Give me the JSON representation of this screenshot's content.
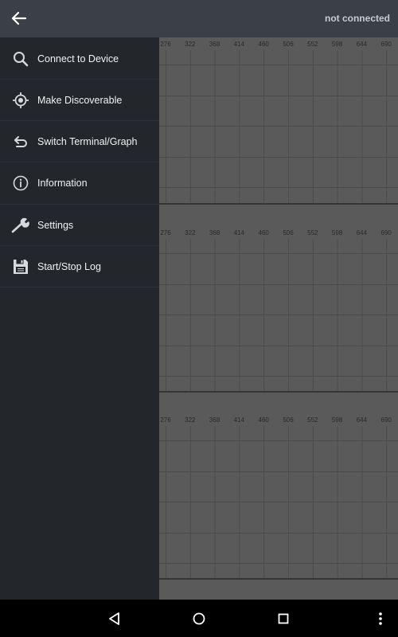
{
  "header": {
    "status_text": "not connected"
  },
  "menu": {
    "items": [
      {
        "label": "Connect to Device",
        "icon": "search-icon"
      },
      {
        "label": "Make Discoverable",
        "icon": "target-icon"
      },
      {
        "label": "Switch Terminal/Graph",
        "icon": "undo-icon"
      },
      {
        "label": "Information",
        "icon": "info-icon"
      },
      {
        "label": "Settings",
        "icon": "wrench-icon"
      },
      {
        "label": "Start/Stop Log",
        "icon": "save-icon"
      }
    ]
  },
  "graphs": {
    "x_ticks": [
      "276",
      "322",
      "368",
      "414",
      "460",
      "506",
      "552",
      "598",
      "644",
      "690"
    ]
  },
  "navigation": {
    "icons": [
      "back-triangle-icon",
      "home-circle-icon",
      "recents-square-icon",
      "overflow-menu-icon"
    ]
  }
}
